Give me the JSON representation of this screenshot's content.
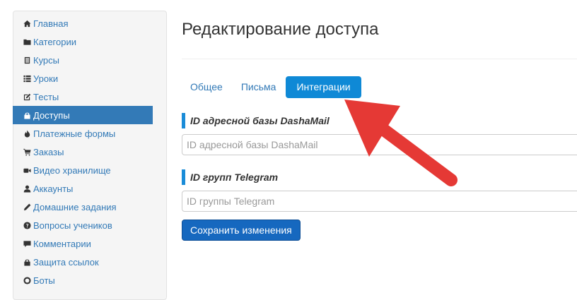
{
  "sidebar": {
    "items": [
      {
        "label": "Главная",
        "icon": "home-icon"
      },
      {
        "label": "Категории",
        "icon": "folder-icon"
      },
      {
        "label": "Курсы",
        "icon": "book-icon"
      },
      {
        "label": "Уроки",
        "icon": "list-icon"
      },
      {
        "label": "Тесты",
        "icon": "edit-icon"
      },
      {
        "label": "Доступы",
        "icon": "lock-icon",
        "active": true
      },
      {
        "label": "Платежные формы",
        "icon": "fire-icon"
      },
      {
        "label": "Заказы",
        "icon": "cart-icon"
      },
      {
        "label": "Видео хранилище",
        "icon": "video-icon"
      },
      {
        "label": "Аккаунты",
        "icon": "user-icon"
      },
      {
        "label": "Домашние задания",
        "icon": "pencil-icon"
      },
      {
        "label": "Вопросы учеников",
        "icon": "question-icon"
      },
      {
        "label": "Комментарии",
        "icon": "comment-icon"
      },
      {
        "label": "Защита ссылок",
        "icon": "lock-icon"
      },
      {
        "label": "Боты",
        "icon": "bot-icon"
      }
    ]
  },
  "page": {
    "title": "Редактирование доступа"
  },
  "tabs": [
    {
      "label": "Общее"
    },
    {
      "label": "Письма"
    },
    {
      "label": "Интеграции",
      "active": true
    }
  ],
  "form": {
    "dashamail": {
      "label": "ID адресной базы DashaMail",
      "placeholder": "ID адресной базы DashaMail",
      "value": ""
    },
    "telegram": {
      "label": "ID групп Telegram",
      "placeholder": "ID группы Telegram",
      "value": ""
    },
    "save_label": "Сохранить изменения"
  },
  "colors": {
    "accent": "#337ab7",
    "tab_active": "#0f89d6",
    "button": "#1668bf",
    "arrow": "#e53935"
  }
}
